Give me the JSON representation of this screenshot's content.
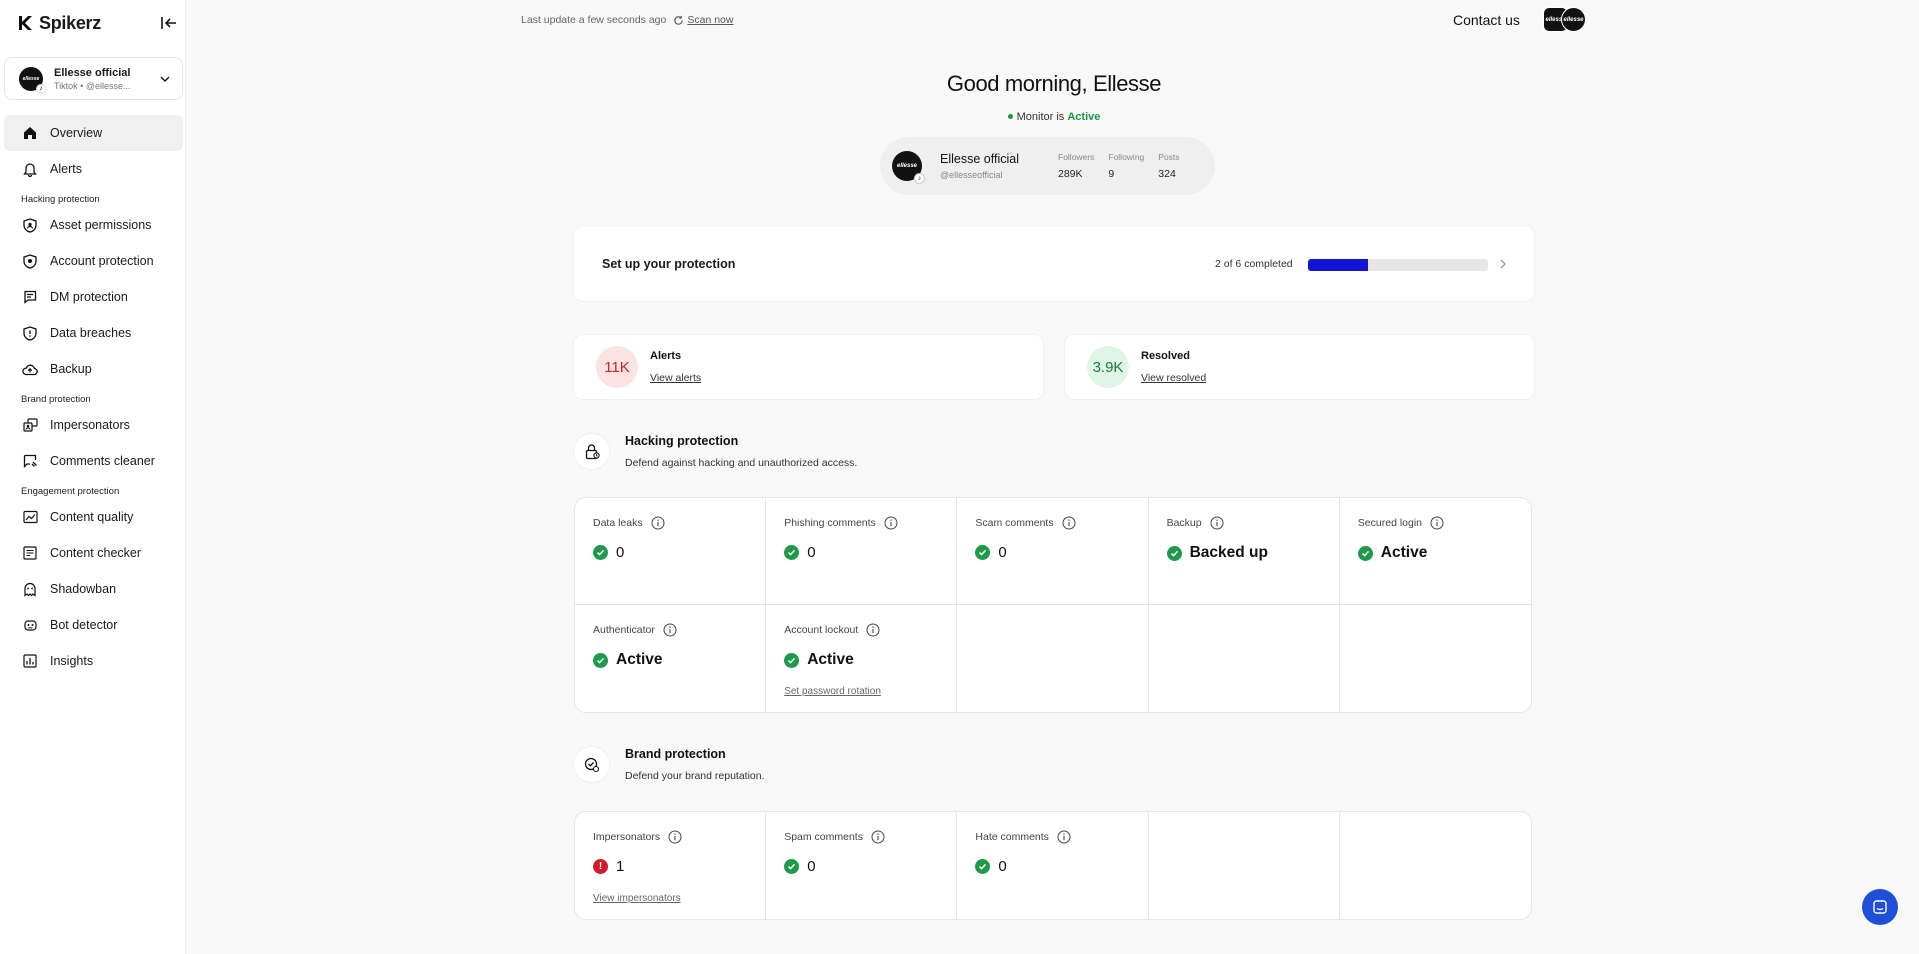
{
  "sidebar": {
    "brand": "Spikerz",
    "account": {
      "name": "Ellesse official",
      "sub": "Tiktok • @ellesse...",
      "avatar_text": "ellesse"
    },
    "items": [
      {
        "label": "Overview",
        "icon": "home-icon",
        "active": true
      },
      {
        "label": "Alerts",
        "icon": "bell-icon"
      }
    ],
    "sections": [
      {
        "title": "Hacking protection",
        "items": [
          {
            "label": "Asset permissions",
            "icon": "shield-user-icon"
          },
          {
            "label": "Account protection",
            "icon": "shield-lock-icon"
          },
          {
            "label": "DM protection",
            "icon": "message-list-icon"
          },
          {
            "label": "Data breaches",
            "icon": "shield-alert-icon"
          },
          {
            "label": "Backup",
            "icon": "cloud-upload-icon"
          }
        ]
      },
      {
        "title": "Brand protection",
        "items": [
          {
            "label": "Impersonators",
            "icon": "people-duplicate-icon"
          },
          {
            "label": "Comments cleaner",
            "icon": "comment-brush-icon"
          }
        ]
      },
      {
        "title": "Engagement protection",
        "items": [
          {
            "label": "Content quality",
            "icon": "image-chart-icon"
          },
          {
            "label": "Content checker",
            "icon": "list-check-icon"
          },
          {
            "label": "Shadowban",
            "icon": "ghost-icon"
          },
          {
            "label": "Bot detector",
            "icon": "robot-icon"
          },
          {
            "label": "Insights",
            "icon": "bar-chart-icon"
          }
        ]
      }
    ]
  },
  "topbar": {
    "last_update": "Last update a few seconds ago",
    "scan_label": "Scan now",
    "contact_label": "Contact us"
  },
  "greeting": "Good morning, Ellesse",
  "monitor": {
    "prefix": "Monitor is",
    "status": "Active",
    "status_color": "#1a9a3e"
  },
  "profile": {
    "name": "Ellesse official",
    "handle": "@ellesseofficial",
    "stats": [
      {
        "label": "Followers",
        "value": "289K"
      },
      {
        "label": "Following",
        "value": "9"
      },
      {
        "label": "Posts",
        "value": "324"
      }
    ]
  },
  "setup": {
    "title": "Set up your protection",
    "status": "2 of 6 completed",
    "completed": 2,
    "total": 6,
    "bar_color": "#1414d4"
  },
  "summary": {
    "alerts": {
      "count": "11K",
      "label": "Alerts",
      "link": "View alerts"
    },
    "resolved": {
      "count": "3.9K",
      "label": "Resolved",
      "link": "View resolved"
    }
  },
  "hacking": {
    "title": "Hacking protection",
    "desc": "Defend against hacking and unauthorized access.",
    "cells": [
      {
        "label": "Data leaks",
        "value": "0",
        "status": "ok",
        "word": false
      },
      {
        "label": "Phishing comments",
        "value": "0",
        "status": "ok",
        "word": false
      },
      {
        "label": "Scam comments",
        "value": "0",
        "status": "ok",
        "word": false
      },
      {
        "label": "Backup",
        "value": "Backed up",
        "status": "ok",
        "word": true
      },
      {
        "label": "Secured login",
        "value": "Active",
        "status": "ok",
        "word": true
      },
      {
        "label": "Authenticator",
        "value": "Active",
        "status": "ok",
        "word": true
      },
      {
        "label": "Account lockout",
        "value": "Active",
        "status": "ok",
        "word": true,
        "link": "Set password rotation"
      }
    ]
  },
  "brand": {
    "title": "Brand protection",
    "desc": "Defend your brand reputation.",
    "cells": [
      {
        "label": "Impersonators",
        "value": "1",
        "status": "warn",
        "word": false,
        "link": "View impersonators"
      },
      {
        "label": "Spam comments",
        "value": "0",
        "status": "ok",
        "word": false
      },
      {
        "label": "Hate comments",
        "value": "0",
        "status": "ok",
        "word": false
      }
    ]
  }
}
